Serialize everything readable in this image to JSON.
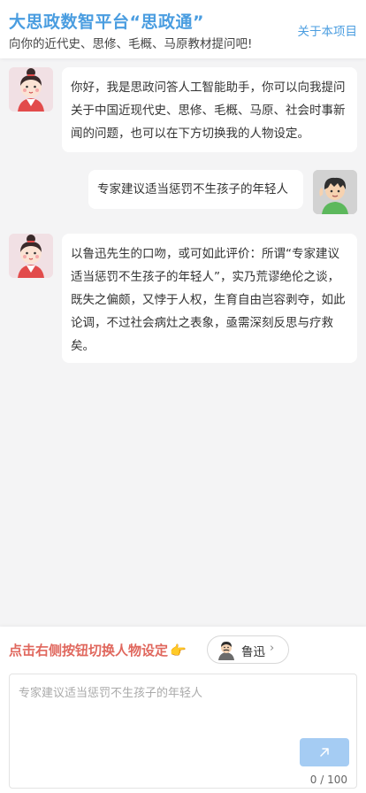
{
  "header": {
    "title": "大思政数智平台“思政通”",
    "subtitle": "向你的近代史、思修、毛概、马原教材提问吧!",
    "about_link": "关于本项目"
  },
  "messages": [
    {
      "role": "assistant",
      "text": "你好，我是思政问答人工智能助手，你可以向我提问关于中国近现代史、思修、毛概、马原、社会时事新闻的问题，也可以在下方切换我的人物设定。"
    },
    {
      "role": "user",
      "text": "专家建议适当惩罚不生孩子的年轻人"
    },
    {
      "role": "assistant",
      "text": "以鲁迅先生的口吻，或可如此评价：所谓“专家建议适当惩罚不生孩子的年轻人”，实乃荒谬绝伦之谈，既失之偏颇，又悖于人权，生育自由岂容剥夺，如此论调，不过社会病灶之表象，亟需深刻反思与疗救矣。"
    }
  ],
  "input_panel": {
    "switch_hint": "点击右侧按钮切换人物设定",
    "persona_name": "鲁迅",
    "placeholder": "专家建议适当惩罚不生孩子的年轻人",
    "counter": "0 / 100"
  },
  "icons": {
    "assistant_avatar": "girl-avatar-icon",
    "user_avatar": "boy-avatar-icon",
    "persona_avatar": "luxun-avatar-icon",
    "hand": "pointing-hand-icon",
    "send": "arrow-up-right-icon",
    "chevron": "chevron-right-icon"
  },
  "colors": {
    "accent": "#4a9de0",
    "hint": "#e0675d",
    "send_button": "#a5ccf3",
    "background": "#f4f4f5"
  }
}
